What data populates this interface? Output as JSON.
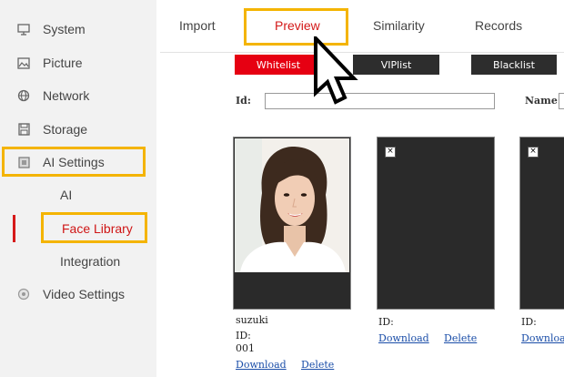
{
  "sidebar": {
    "items": [
      {
        "label": "System",
        "icon": "monitor-icon"
      },
      {
        "label": "Picture",
        "icon": "picture-icon"
      },
      {
        "label": "Network",
        "icon": "globe-icon"
      },
      {
        "label": "Storage",
        "icon": "storage-icon"
      },
      {
        "label": "AI Settings",
        "icon": "ai-chip-icon"
      },
      {
        "label": "Video Settings",
        "icon": "video-settings-icon"
      }
    ],
    "sub_items": [
      {
        "label": "AI"
      },
      {
        "label": "Face Library"
      },
      {
        "label": "Integration"
      }
    ]
  },
  "tabs": [
    {
      "label": "Import"
    },
    {
      "label": "Preview"
    },
    {
      "label": "Similarity"
    },
    {
      "label": "Records"
    }
  ],
  "lists": {
    "whitelist": "Whitelist",
    "viplist": "VIPlist",
    "blacklist": "Blacklist"
  },
  "filters": {
    "id_label": "Id:",
    "name_label": "Name:",
    "id_value": "",
    "name_value": ""
  },
  "cards": [
    {
      "name": "suzuki",
      "id_label": "ID:",
      "id_value": "001",
      "download": "Download",
      "delete": "Delete"
    },
    {
      "id_label": "ID:",
      "download": "Download",
      "delete": "Delete"
    },
    {
      "id_label": "ID:",
      "download": "Downloa"
    }
  ],
  "colors": {
    "accent_red": "#e60012",
    "highlight": "#f4b400",
    "dark_button": "#2d2d2d",
    "link": "#1a4da8"
  }
}
